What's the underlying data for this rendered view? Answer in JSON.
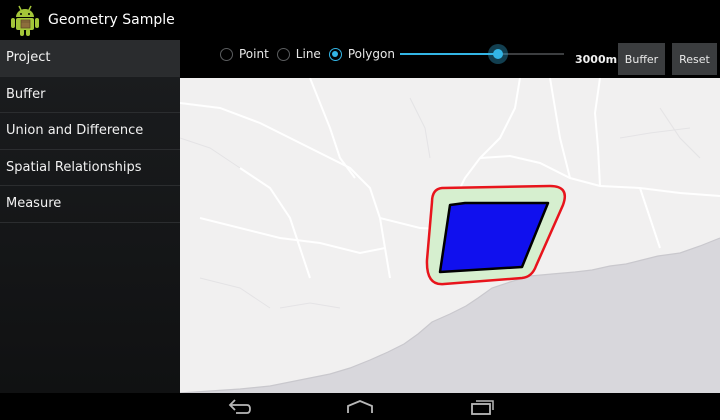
{
  "app": {
    "title": "Geometry Sample",
    "icon": "android-robot-icon"
  },
  "sidebar": {
    "items": [
      {
        "label": "Project"
      },
      {
        "label": "Buffer"
      },
      {
        "label": "Union and Difference"
      },
      {
        "label": "Spatial Relationships"
      },
      {
        "label": "Measure"
      }
    ]
  },
  "toolbar": {
    "geometry_types": [
      {
        "label": "Point",
        "checked": false
      },
      {
        "label": "Line",
        "checked": false
      },
      {
        "label": "Polygon",
        "checked": true
      }
    ],
    "buffer_distance_label": "3000m",
    "slider_fraction": 0.6,
    "buffer_button": "Buffer",
    "reset_button": "Reset"
  },
  "colors": {
    "accent": "#33b5e5",
    "polygon_fill": "#1010ee",
    "buffer_outline": "#e8141c",
    "buffer_fill": "#d6efcf",
    "water": "#d8d7dc",
    "land": "#f1f0f0"
  },
  "navbar": {
    "icons": [
      "back-icon",
      "home-icon",
      "recent-apps-icon"
    ]
  }
}
